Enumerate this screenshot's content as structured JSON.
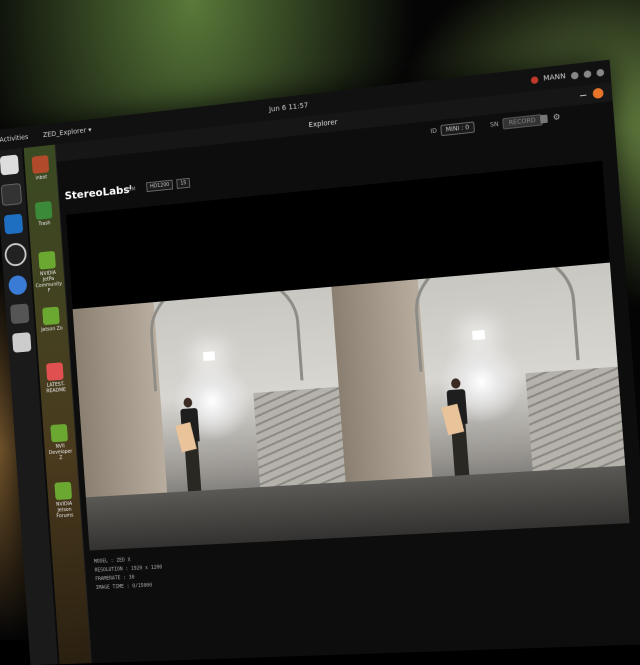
{
  "topbar": {
    "activities": "Activities",
    "app_menu": "ZED_Explorer ▾",
    "clock": "Jun 6  11:57",
    "keyboard": "MANN"
  },
  "desktop": {
    "items": [
      {
        "label": "inbot",
        "color": "#b04a2a"
      },
      {
        "label": "Trash",
        "color": "#3a8a3a"
      },
      {
        "label": "NVIDIA JetPa Community F",
        "color": "#6aa832"
      },
      {
        "label": "Jetson Zo",
        "color": "#6aa832"
      },
      {
        "label": "LATEST-README",
        "color": "#e05050"
      },
      {
        "label": "NVII Developer Z",
        "color": "#6aa832"
      },
      {
        "label": "NVIDIA Jetson Forums",
        "color": "#6aa832"
      }
    ]
  },
  "window": {
    "title": "Explorer",
    "toolbar": {
      "id_label": "ID",
      "camera_select": "MINI : 0",
      "sn_label": "SN",
      "record_button": "RECORD"
    },
    "brand": "StereoLabsⁱ",
    "mode_label": "1.5M",
    "resolution_select": "HD1200",
    "fps_select": "15",
    "info": [
      "MODEL : ZED X",
      "RESOLUTION : 1920 x 1200",
      "FRAMERATE : 30",
      "IMAGE TIME : 0/15000"
    ]
  }
}
